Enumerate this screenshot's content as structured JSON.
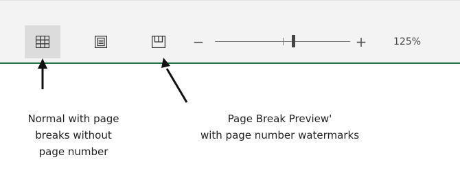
{
  "statusbar": {
    "accent": "#217346",
    "view_buttons": [
      {
        "icon": "grid-icon",
        "name": "normal-view",
        "active": true
      },
      {
        "icon": "page-layout-icon",
        "name": "page-layout-view",
        "active": false
      },
      {
        "icon": "page-break-preview-icon",
        "name": "page-break-preview-view",
        "active": false
      }
    ],
    "zoom": {
      "minus": "−",
      "plus": "+",
      "level": "125%",
      "slider_fraction": 0.58
    }
  },
  "annotations": {
    "normal": [
      "Normal with page",
      "breaks without",
      "page number"
    ],
    "page_break": [
      "Page Break Preview'",
      "with page number watermarks"
    ]
  }
}
